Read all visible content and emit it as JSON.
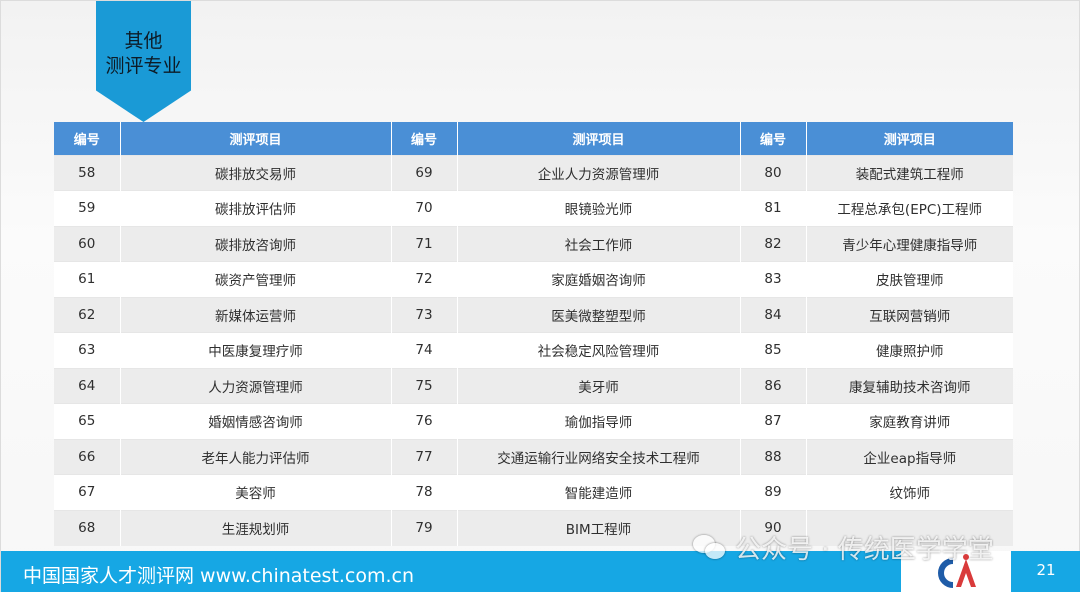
{
  "header": {
    "ribbon_line1": "其他",
    "ribbon_line2": "测评专业"
  },
  "table": {
    "columns": [
      "编号",
      "测评项目",
      "编号",
      "测评项目",
      "编号",
      "测评项目"
    ],
    "rows": [
      [
        "58",
        "碳排放交易师",
        "69",
        "企业人力资源管理师",
        "80",
        "装配式建筑工程师"
      ],
      [
        "59",
        "碳排放评估师",
        "70",
        "眼镜验光师",
        "81",
        "工程总承包(EPC)工程师"
      ],
      [
        "60",
        "碳排放咨询师",
        "71",
        "社会工作师",
        "82",
        "青少年心理健康指导师"
      ],
      [
        "61",
        "碳资产管理师",
        "72",
        "家庭婚姻咨询师",
        "83",
        "皮肤管理师"
      ],
      [
        "62",
        "新媒体运营师",
        "73",
        "医美微整塑型师",
        "84",
        "互联网营销师"
      ],
      [
        "63",
        "中医康复理疗师",
        "74",
        "社会稳定风险管理师",
        "85",
        "健康照护师"
      ],
      [
        "64",
        "人力资源管理师",
        "75",
        "美牙师",
        "86",
        "康复辅助技术咨询师"
      ],
      [
        "65",
        "婚姻情感咨询师",
        "76",
        "瑜伽指导师",
        "87",
        "家庭教育讲师"
      ],
      [
        "66",
        "老年人能力评估师",
        "77",
        "交通运输行业网络安全技术工程师",
        "88",
        "企业eap指导师"
      ],
      [
        "67",
        "美容师",
        "78",
        "智能建造师",
        "89",
        "纹饰师"
      ],
      [
        "68",
        "生涯规划师",
        "79",
        "BIM工程师",
        "90",
        ""
      ]
    ]
  },
  "footer": {
    "text": "中国国家人才测评网 www.chinatest.com.cn",
    "page_number": "21"
  },
  "watermark": {
    "icon": "wechat-icon",
    "text": "公众号 · 传统医学学堂"
  },
  "colors": {
    "accent": "#1a9ad6",
    "table_header": "#4a8fd6",
    "footer_bar": "#16a7e4",
    "logo_blue": "#1f5ca8",
    "logo_red": "#d93a3a"
  }
}
